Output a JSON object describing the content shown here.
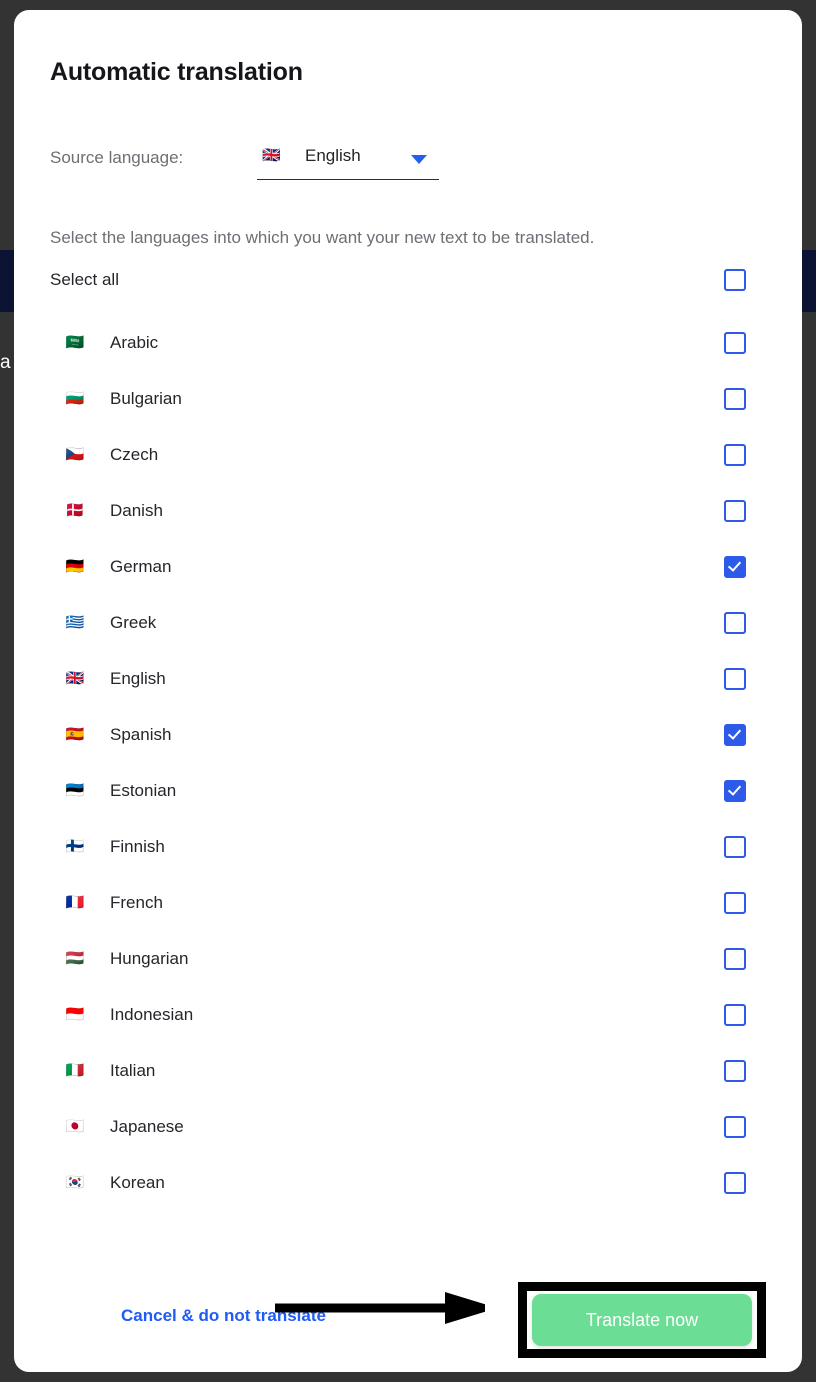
{
  "background": {
    "page_color": "#333333",
    "band_color": "#0b1433",
    "glyph": "a"
  },
  "dialog": {
    "title": "Automatic translation",
    "source": {
      "label": "Source language:",
      "value": "English",
      "flag": "🇬🇧",
      "chevron_icon": "chevron-down-icon"
    },
    "instruction": "Select the languages into which you want your new text to be translated.",
    "select_all": {
      "label": "Select all",
      "checked": false
    },
    "languages": [
      {
        "name": "Arabic",
        "flag": "🇸🇦",
        "checked": false
      },
      {
        "name": "Bulgarian",
        "flag": "🇧🇬",
        "checked": false
      },
      {
        "name": "Czech",
        "flag": "🇨🇿",
        "checked": false
      },
      {
        "name": "Danish",
        "flag": "🇩🇰",
        "checked": false
      },
      {
        "name": "German",
        "flag": "🇩🇪",
        "checked": true
      },
      {
        "name": "Greek",
        "flag": "🇬🇷",
        "checked": false
      },
      {
        "name": "English",
        "flag": "🇬🇧",
        "checked": false
      },
      {
        "name": "Spanish",
        "flag": "🇪🇸",
        "checked": true
      },
      {
        "name": "Estonian",
        "flag": "🇪🇪",
        "checked": true
      },
      {
        "name": "Finnish",
        "flag": "🇫🇮",
        "checked": false
      },
      {
        "name": "French",
        "flag": "🇫🇷",
        "checked": false
      },
      {
        "name": "Hungarian",
        "flag": "🇭🇺",
        "checked": false
      },
      {
        "name": "Indonesian",
        "flag": "🇮🇩",
        "checked": false
      },
      {
        "name": "Italian",
        "flag": "🇮🇹",
        "checked": false
      },
      {
        "name": "Japanese",
        "flag": "🇯🇵",
        "checked": false
      },
      {
        "name": "Korean",
        "flag": "🇰🇷",
        "checked": false
      }
    ],
    "footer": {
      "cancel_label": "Cancel & do not translate",
      "submit_label": "Translate now"
    }
  },
  "colors": {
    "accent_blue": "#2d5ae8",
    "link_blue": "#1f5bf5",
    "submit_green": "#6cdd94",
    "annotation_black": "#000000"
  }
}
